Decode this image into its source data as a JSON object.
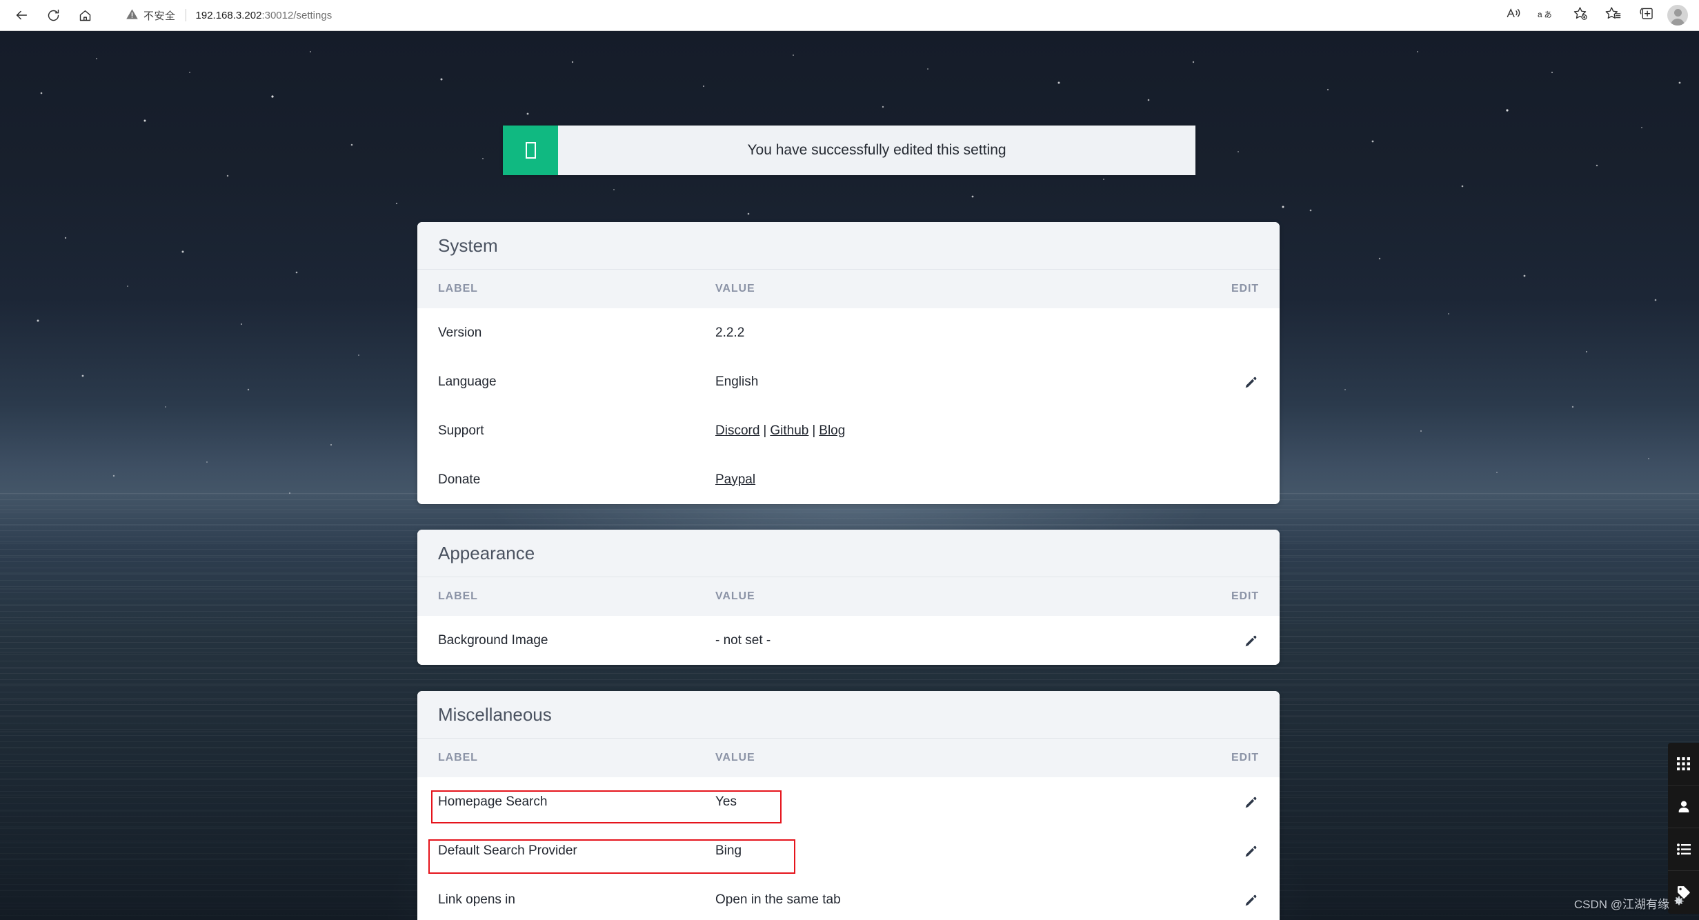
{
  "browser": {
    "back_icon": "back-arrow-icon",
    "reload_icon": "reload-icon",
    "home_icon": "home-icon",
    "security_icon": "warning-triangle-icon",
    "security_label": "不安全",
    "url_host": "192.168.3.202",
    "url_rest": ":30012/settings",
    "read_aloud_icon": "read-aloud-icon",
    "translate_icon": "translate-icon",
    "add_favorite_icon": "add-favorite-star-icon",
    "favorites_icon": "favorites-list-icon",
    "collections_icon": "collections-icon",
    "profile_icon": "profile-avatar-icon"
  },
  "notification": {
    "icon": "check-glyph-missing",
    "message": "You have successfully edited this setting",
    "accent_color": "#10b981",
    "background_color": "#eff2f5"
  },
  "table_headers": {
    "label": "LABEL",
    "value": "VALUE",
    "edit": "EDIT"
  },
  "cards": [
    {
      "id": "system",
      "title": "System",
      "rows": [
        {
          "label": "Version",
          "value": "2.2.2",
          "editable": false
        },
        {
          "label": "Language",
          "value": "English",
          "editable": true
        },
        {
          "label": "Support",
          "links": [
            "Discord",
            "Github",
            "Blog"
          ],
          "separator": "|",
          "editable": false
        },
        {
          "label": "Donate",
          "links": [
            "Paypal"
          ],
          "editable": false
        }
      ]
    },
    {
      "id": "appearance",
      "title": "Appearance",
      "rows": [
        {
          "label": "Background Image",
          "value": "- not set -",
          "editable": true
        }
      ]
    },
    {
      "id": "miscellaneous",
      "title": "Miscellaneous",
      "rows": [
        {
          "label": "Homepage Search",
          "value": "Yes",
          "editable": true,
          "highlighted": true
        },
        {
          "label": "Default Search Provider",
          "value": "Bing",
          "editable": true,
          "highlighted": true
        },
        {
          "label": "Link opens in",
          "value": "Open in the same tab",
          "editable": true
        }
      ]
    }
  ],
  "side_toolbar": {
    "items": [
      {
        "icon": "grid-apps-icon",
        "name": "apps"
      },
      {
        "icon": "person-icon",
        "name": "account"
      },
      {
        "icon": "list-icon",
        "name": "list"
      },
      {
        "icon": "tag-icon",
        "name": "tags"
      }
    ]
  },
  "watermark": {
    "text": "CSDN @江湖有缘"
  },
  "annotations": {
    "color": "#e5141c",
    "boxes": [
      "Homepage Search",
      "Default Search Provider"
    ]
  }
}
